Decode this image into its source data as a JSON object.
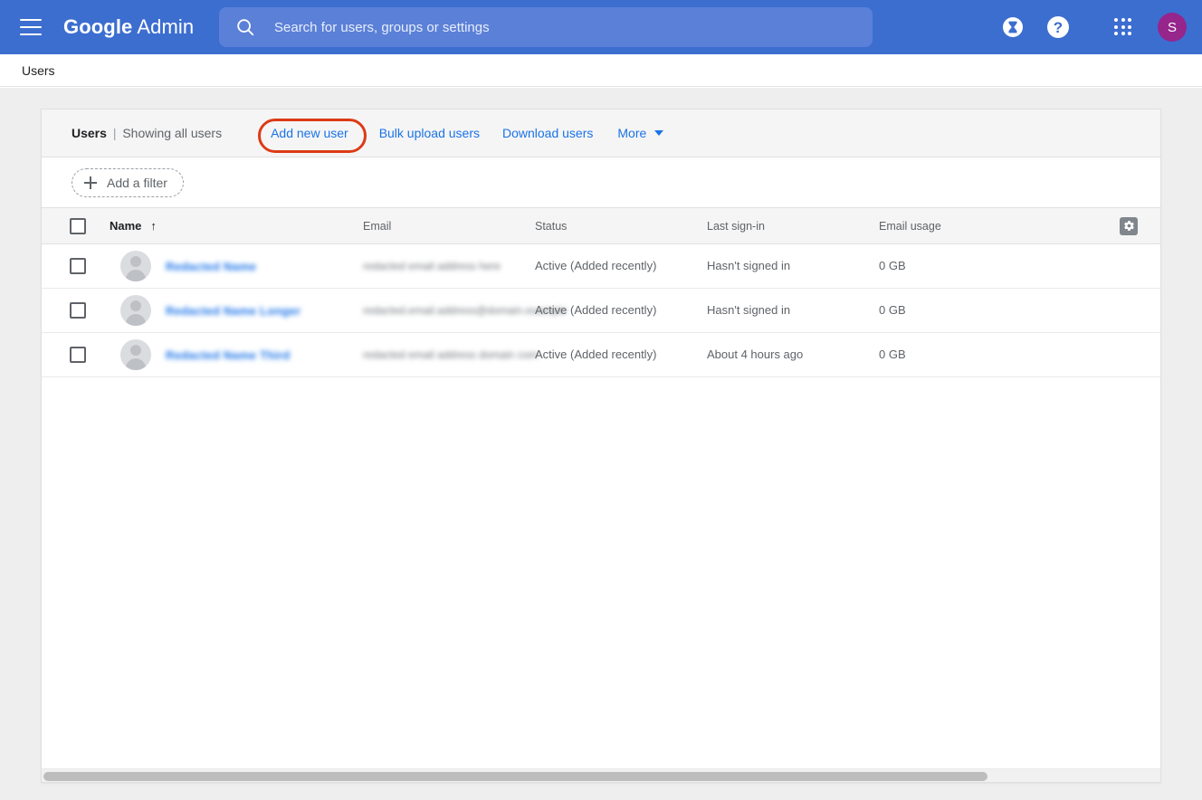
{
  "appbar": {
    "menu_icon": "hamburger-menu-icon",
    "brand_google": "Google",
    "brand_admin": "Admin",
    "search": {
      "icon": "search-icon",
      "placeholder": "Search for users, groups or settings",
      "value": ""
    },
    "trial_icon": "hourglass-icon",
    "help_label": "?",
    "apps_icon": "apps-grid-icon",
    "avatar_initial": "S",
    "avatar_color": "#96258c",
    "background_color": "#3c6ed0"
  },
  "breadcrumb": {
    "label": "Users"
  },
  "card": {
    "toolbar": {
      "title": "Users",
      "separator": "|",
      "subtitle": "Showing all users",
      "add_new_user": "Add new user",
      "bulk_upload_users": "Bulk upload users",
      "download_users": "Download users",
      "more": "More",
      "more_caret_icon": "caret-down-icon",
      "highlight_color": "#dd3a15",
      "link_color": "#1a73e8"
    },
    "filter": {
      "add_filter_label": "Add a filter",
      "plus_icon": "plus-icon"
    },
    "table": {
      "select_all_checkbox": "unchecked",
      "columns": [
        {
          "key": "name",
          "label": "Name",
          "sorted": true,
          "sort_icon": "arrow-up-icon"
        },
        {
          "key": "email",
          "label": "Email"
        },
        {
          "key": "status",
          "label": "Status"
        },
        {
          "key": "signin",
          "label": "Last sign-in"
        },
        {
          "key": "usage",
          "label": "Email usage"
        }
      ],
      "settings_icon": "gear-icon",
      "rows": [
        {
          "checkbox": "unchecked",
          "avatar": "person-avatar-icon",
          "name": "Redacted Name",
          "email": "redacted email address here",
          "status": "Active (Added recently)",
          "last_signin": "Hasn't signed in",
          "email_usage": "0 GB"
        },
        {
          "checkbox": "unchecked",
          "avatar": "person-avatar-icon",
          "name": "Redacted Name Longer",
          "email": "redacted.email.address@domain.example",
          "status": "Active (Added recently)",
          "last_signin": "Hasn't signed in",
          "email_usage": "0 GB"
        },
        {
          "checkbox": "unchecked",
          "avatar": "person-avatar-icon",
          "name": "Redacted Name Third",
          "email": "redacted email address domain com",
          "status": "Active (Added recently)",
          "last_signin": "About 4 hours ago",
          "email_usage": "0 GB"
        }
      ]
    },
    "horizontal_scrollbar": "scrollbar-thumb"
  }
}
